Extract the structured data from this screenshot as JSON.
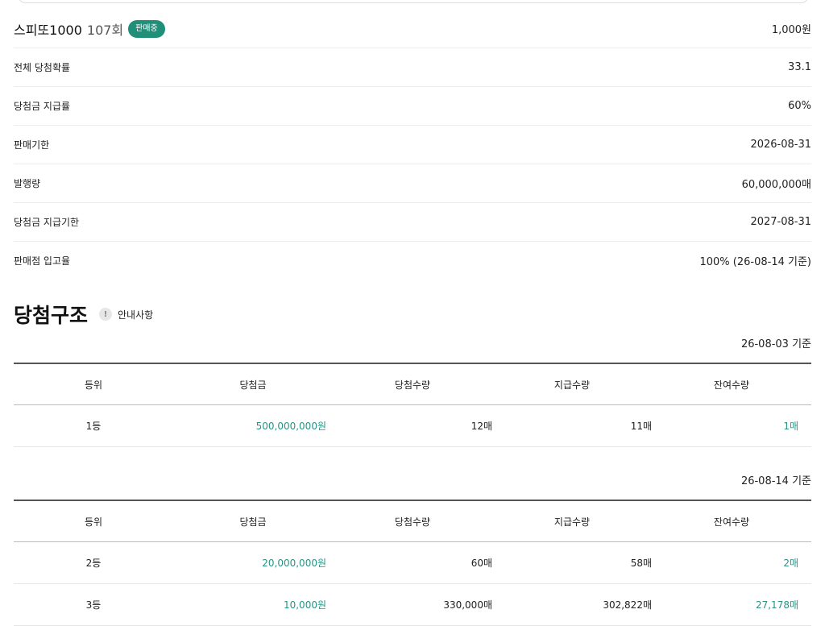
{
  "product": {
    "name": "스피또1000",
    "round": "107회",
    "status": "판매중",
    "price": "1,000원",
    "accent": "#1f8f7a"
  },
  "info": [
    {
      "label": "전체 당첨확률",
      "value": "33.1"
    },
    {
      "label": "당첨금 지급률",
      "value": "60%"
    },
    {
      "label": "판매기한",
      "value": "2026-08-31"
    },
    {
      "label": "발행량",
      "value": "60,000,000매"
    },
    {
      "label": "당첨금 지급기한",
      "value": "2027-08-31"
    },
    {
      "label": "판매점 입고율",
      "value": "100% (26-08-14 기준)"
    }
  ],
  "structure": {
    "title": "당첨구조",
    "notice_icon": "exclamation-icon",
    "notice_icon_glyph": "!",
    "notice_label": "안내사항"
  },
  "columns": [
    "등위",
    "당첨금",
    "당첨수량",
    "지급수량",
    "잔여수량"
  ],
  "table1": {
    "as_of": "26-08-03 기준",
    "rows": [
      {
        "rank": "1등",
        "prize": "500,000,000원",
        "total": "12매",
        "paid": "11매",
        "remain": "1매"
      }
    ]
  },
  "table2": {
    "as_of": "26-08-14 기준",
    "rows": [
      {
        "rank": "2등",
        "prize": "20,000,000원",
        "total": "60매",
        "paid": "58매",
        "remain": "2매"
      },
      {
        "rank": "3등",
        "prize": "10,000원",
        "total": "330,000매",
        "paid": "302,822매",
        "remain": "27,178매"
      }
    ]
  }
}
